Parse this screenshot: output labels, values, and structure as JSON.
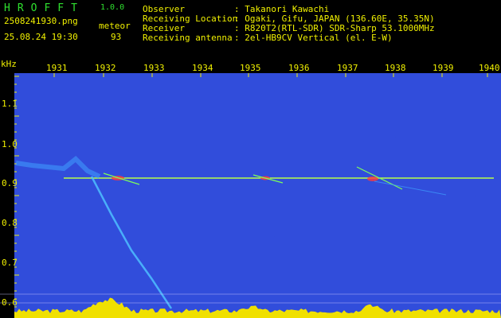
{
  "app": {
    "logo": "HROFFT",
    "version": "1.0.0",
    "filename": "2508241930.png",
    "datetime": "25.08.24 19:30",
    "meteor_label": "meteor",
    "meteor_count": "93"
  },
  "info": [
    {
      "label": "Observer",
      "value": ": Takanori Kawachi"
    },
    {
      "label": "Receiving Location",
      "value": ": Ogaki, Gifu, JAPAN (136.60E, 35.35N)"
    },
    {
      "label": "Receiver",
      "value": ": R820T2(RTL-SDR) SDR-Sharp 53.1000MHz"
    },
    {
      "label": "Receiving antenna",
      "value": ": 2el-HB9CV Vertical (el. E-W)"
    }
  ],
  "axis": {
    "unit": "kHz",
    "x_ticks": [
      "1931",
      "1932",
      "1933",
      "1934",
      "1935",
      "1936",
      "1937",
      "1938",
      "1939",
      "1940"
    ],
    "y_ticks": [
      "1.1",
      "1.0",
      "0.9",
      "0.8",
      "0.7",
      "0.6"
    ]
  },
  "colors": {
    "header_green": "#2fe02f",
    "label_yellow": "#f0f000",
    "background_blue": "#0a1270",
    "trace_green": "#7cff5a"
  }
}
